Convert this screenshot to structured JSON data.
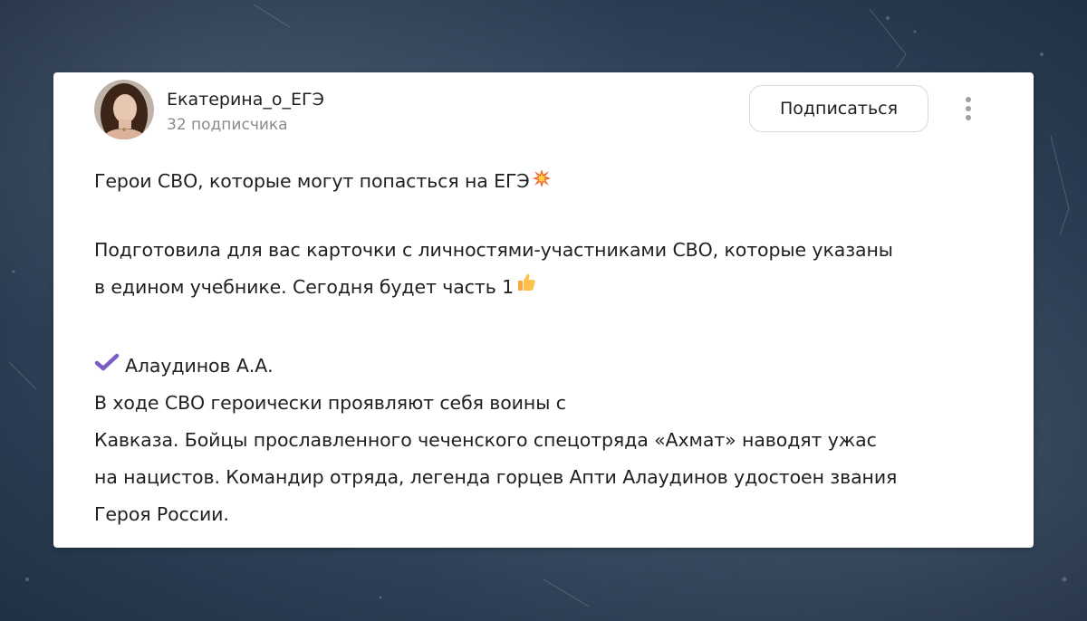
{
  "author": {
    "name": "Екатерина_о_ЕГЭ",
    "subscribers": "32 подписчика"
  },
  "actions": {
    "subscribe_label": "Подписаться",
    "more_icon": "vertical-dots-icon"
  },
  "post": {
    "title": "Герои СВО, которые могут попасться на ЕГЭ",
    "title_emoji": "collision-icon",
    "intro_line1": "Подготовила для вас карточки с личностями-участниками СВО, которые указаны",
    "intro_line2": "в едином учебнике. Сегодня будет часть 1",
    "intro_emoji": "thumbs-up-icon",
    "item_marker": "check-mark-icon",
    "item_heading": "Алаудинов А.А.",
    "item_line1": "В ходе СВО героически проявляют себя воины с",
    "item_line2": "Кавказа. Бойцы прославленного чеченского спецотряда «Ахмат» наводят ужас",
    "item_line3": "на нацистов. Командир отряда, легенда горцев Апти Алаудинов удостоен звания",
    "item_line4": "Героя России."
  },
  "colors": {
    "background": "#3b5068",
    "card": "#ffffff",
    "check_mark": "#7b5cc4",
    "subscribers_text": "#8a8a8a"
  }
}
